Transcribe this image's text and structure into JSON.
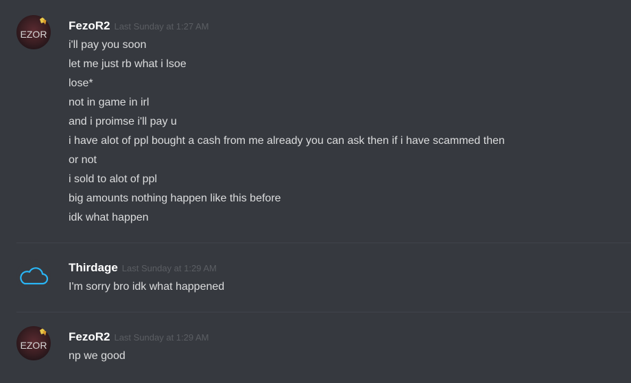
{
  "colors": {
    "background": "#36393f",
    "username": "#ffffff",
    "timestamp": "#5b5e63",
    "message_text": "#dcddde",
    "divider": "#40444b",
    "cloud_icon": "#29b6f6"
  },
  "messages": [
    {
      "author": "FezoR2",
      "timestamp": "Last Sunday at 1:27 AM",
      "avatar_text": "EZOR",
      "lines": [
        "i'll pay you soon",
        "let me just rb what i lsoe",
        "lose*",
        "not in game in irl",
        "and i proimse i'll pay u",
        "i have alot of ppl bought a cash from me already you can ask then if i have scammed then",
        "or not",
        "i sold to alot of ppl",
        "big amounts nothing happen like this before",
        "idk what happen"
      ]
    },
    {
      "author": "Thirdage",
      "timestamp": "Last Sunday at 1:29 AM",
      "avatar_icon": "cloud-icon",
      "lines": [
        "I'm sorry bro idk what happened"
      ]
    },
    {
      "author": "FezoR2",
      "timestamp": "Last Sunday at 1:29 AM",
      "avatar_text": "EZOR",
      "lines": [
        "np we good"
      ]
    }
  ]
}
